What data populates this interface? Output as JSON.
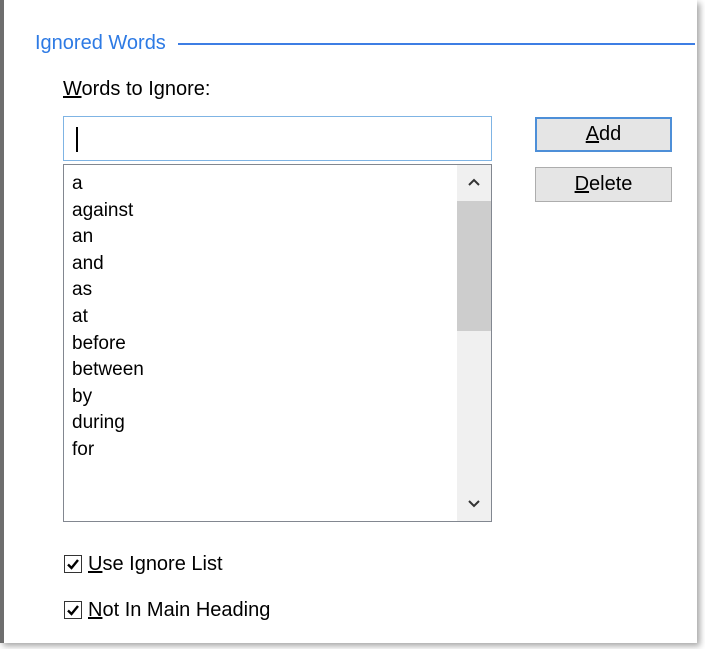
{
  "group": {
    "title": "Ignored Words"
  },
  "words_label": {
    "mnemonic": "W",
    "rest": "ords to Ignore:"
  },
  "word_input": {
    "value": ""
  },
  "word_list": {
    "items": [
      "a",
      "against",
      "an",
      "and",
      "as",
      "at",
      "before",
      "between",
      "by",
      "during",
      "for"
    ]
  },
  "buttons": {
    "add": {
      "mnemonic": "A",
      "rest": "dd"
    },
    "delete": {
      "mnemonic": "D",
      "rest": "elete"
    }
  },
  "options": {
    "use_ignore_list": {
      "mnemonic": "U",
      "rest": "se Ignore List",
      "checked": true
    },
    "not_in_main_heading": {
      "mnemonic": "N",
      "rest": "ot In Main Heading",
      "checked": true
    }
  },
  "icons": {
    "scroll_up": "chevron-up-icon",
    "scroll_down": "chevron-down-icon",
    "check": "checkmark-icon"
  },
  "colors": {
    "group_title": "#2d7ae4",
    "input_border": "#7fb4e4",
    "default_button_border": "#4d8fd8"
  }
}
